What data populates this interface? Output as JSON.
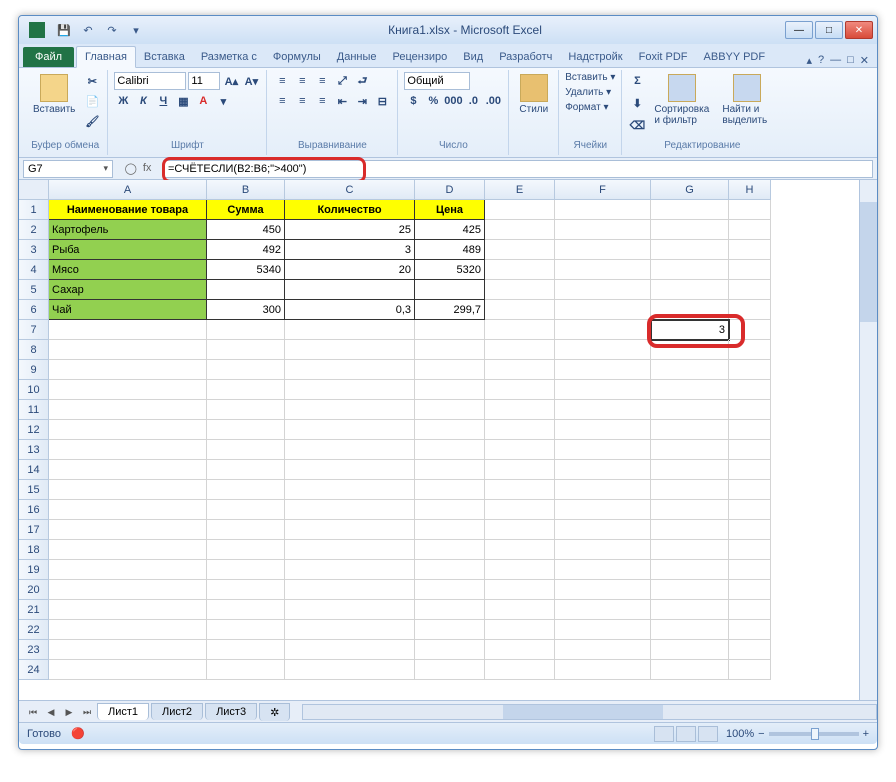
{
  "title": "Книга1.xlsx - Microsoft Excel",
  "qat": {
    "save": "💾",
    "undo": "↶",
    "redo": "↷"
  },
  "tabs": {
    "file": "Файл",
    "home": "Главная",
    "insert": "Вставка",
    "layout": "Разметка с",
    "formulas": "Формулы",
    "data": "Данные",
    "review": "Рецензиро",
    "view": "Вид",
    "developer": "Разработч",
    "addins": "Надстройк",
    "foxit": "Foxit PDF",
    "abbyy": "ABBYY PDF"
  },
  "ribbon": {
    "clipboard": {
      "paste": "Вставить",
      "label": "Буфер обмена"
    },
    "font": {
      "name": "Calibri",
      "size": "11",
      "label": "Шрифт"
    },
    "align": {
      "label": "Выравнивание"
    },
    "number": {
      "format": "Общий",
      "label": "Число"
    },
    "styles": {
      "styles": "Стили",
      "label": ""
    },
    "cells": {
      "insert": "Вставить ▾",
      "delete": "Удалить ▾",
      "format": "Формат ▾",
      "label": "Ячейки"
    },
    "editing": {
      "sort": "Сортировка и фильтр",
      "find": "Найти и выделить",
      "label": "Редактирование"
    }
  },
  "namebox": "G7",
  "formula": "=СЧЁТЕСЛИ(B2:B6;\">400\")",
  "fx": "fx",
  "columns": [
    "A",
    "B",
    "C",
    "D",
    "E",
    "F",
    "G",
    "H"
  ],
  "headers": {
    "a": "Наименование товара",
    "b": "Сумма",
    "c": "Количество",
    "d": "Цена"
  },
  "data": [
    {
      "name": "Картофель",
      "sum": "450",
      "qty": "25",
      "price": "425"
    },
    {
      "name": "Рыба",
      "sum": "492",
      "qty": "3",
      "price": "489"
    },
    {
      "name": "Мясо",
      "sum": "5340",
      "qty": "20",
      "price": "5320"
    },
    {
      "name": "Сахар",
      "sum": "",
      "qty": "",
      "price": ""
    },
    {
      "name": "Чай",
      "sum": "300",
      "qty": "0,3",
      "price": "299,7"
    }
  ],
  "result": "3",
  "sheets": {
    "s1": "Лист1",
    "s2": "Лист2",
    "s3": "Лист3"
  },
  "status": "Готово",
  "zoom": "100%"
}
